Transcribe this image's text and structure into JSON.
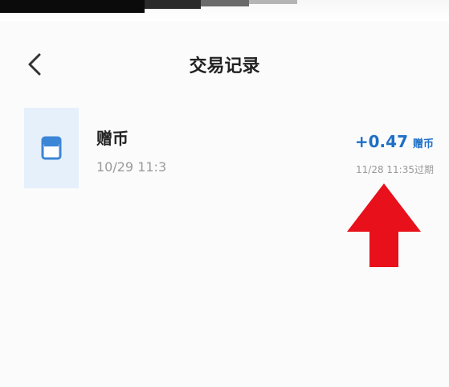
{
  "header": {
    "title": "交易记录",
    "back_icon": "chevron-left-icon"
  },
  "record": {
    "icon": "envelope-icon",
    "title": "赠币",
    "date": "10/29 11:3",
    "amount": "+0.47",
    "amount_unit": "赠币",
    "expire": "11/28 11:35过期"
  },
  "colors": {
    "accent": "#1e6fc6",
    "thumb_bg": "#e6f0fb",
    "annotation": "#e8101a"
  }
}
